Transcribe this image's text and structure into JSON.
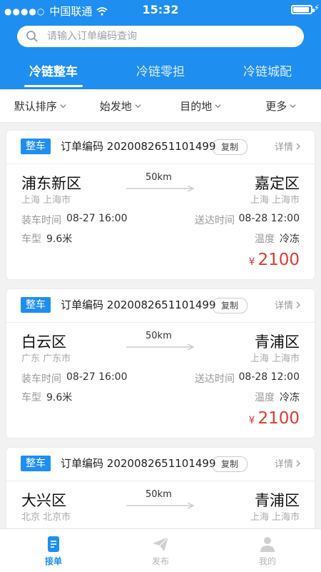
{
  "status": {
    "carrier": "中国联通",
    "time": "15:32",
    "battery_level": 0.9
  },
  "search": {
    "placeholder": "请输入订单编码查询"
  },
  "tabs": [
    {
      "label": "冷链整车",
      "active": true
    },
    {
      "label": "冷链零担",
      "active": false
    },
    {
      "label": "冷链城配",
      "active": false
    }
  ],
  "filters": [
    {
      "label": "默认排序"
    },
    {
      "label": "始发地"
    },
    {
      "label": "目的地"
    },
    {
      "label": "更多"
    }
  ],
  "orders": [
    {
      "type": "整车",
      "order_label": "订单编码",
      "order_no": "2020082651101499",
      "copy_label": "复制",
      "detail_label": "详情",
      "from_city": "浦东新区",
      "from_sub": "上海 上海市",
      "to_city": "嘉定区",
      "to_sub": "上海 上海市",
      "distance": "50km",
      "load_label": "装车时间",
      "load_time": "08-27 16:00",
      "deliver_label": "送达时间",
      "deliver_time": "08-28 12:00",
      "vehicle_label": "车型",
      "vehicle": "9.6米",
      "temp_label": "温度",
      "temp": "冷冻",
      "currency": "¥",
      "price": "2100"
    },
    {
      "type": "整车",
      "order_label": "订单编码",
      "order_no": "2020082651101499",
      "copy_label": "复制",
      "detail_label": "详情",
      "from_city": "白云区",
      "from_sub": "广东 广东市",
      "to_city": "青浦区",
      "to_sub": "上海 上海市",
      "distance": "50km",
      "load_label": "装车时间",
      "load_time": "08-27 16:00",
      "deliver_label": "送达时间",
      "deliver_time": "08-28 12:00",
      "vehicle_label": "车型",
      "vehicle": "9.6米",
      "temp_label": "温度",
      "temp": "冷冻",
      "currency": "¥",
      "price": "2100"
    },
    {
      "type": "整车",
      "order_label": "订单编码",
      "order_no": "2020082651101499",
      "copy_label": "复制",
      "detail_label": "详情",
      "from_city": "大兴区",
      "from_sub": "北京 北京市",
      "to_city": "青浦区",
      "to_sub": "上海 上海市",
      "distance": "50km"
    }
  ],
  "tabbar": [
    {
      "label": "接单",
      "icon": "order-list-icon",
      "active": true
    },
    {
      "label": "发布",
      "icon": "paper-plane-icon",
      "active": false
    },
    {
      "label": "我的",
      "icon": "person-icon",
      "active": false
    }
  ],
  "colors": {
    "primary": "#1f8ef1",
    "price": "#e03a2f"
  }
}
